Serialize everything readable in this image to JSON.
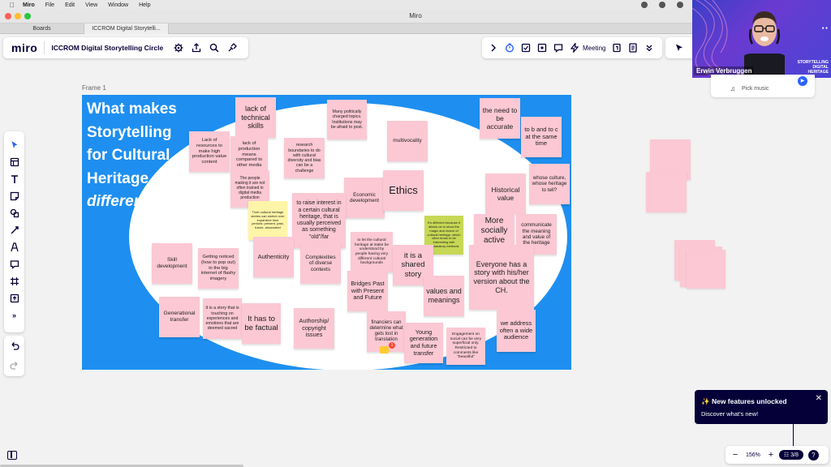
{
  "menubar": {
    "items": [
      "Miro",
      "File",
      "Edit",
      "View",
      "Window",
      "Help"
    ]
  },
  "window": {
    "title": "Miro"
  },
  "tabs": [
    {
      "label": "Boards"
    },
    {
      "label": "ICCROM Digital Storytelli..."
    }
  ],
  "toolbar": {
    "logo": "miro",
    "board_name": "ICCROM Digital Storytelling Circle",
    "meeting_label": "Meeting"
  },
  "video": {
    "name": "Erwin Verbruggen",
    "logo_line1": "STORYTELLING",
    "logo_line2": "DIGITAL",
    "logo_line3": "HERITAGE"
  },
  "music": {
    "label": "Pick music"
  },
  "frame": {
    "label": "Frame 1",
    "heading_lines": [
      "What makes",
      "Storytelling",
      "for Cultural",
      "Heritage"
    ],
    "heading_italic": "differen"
  },
  "stickies": [
    {
      "text": "lack of technical skills"
    },
    {
      "text": "Lack of resources to make high production value content"
    },
    {
      "text": "lack of production means compared to other media"
    },
    {
      "text": "The people making it are not often trained in digital media production"
    },
    {
      "text": "research boundaries to do with cultural diversity and bias can be a challenge"
    },
    {
      "text": "Many politically charged topics. Institutions may be afraid to post."
    },
    {
      "text": "multivocality"
    },
    {
      "text": "the need to be accurate"
    },
    {
      "text": "to b and to c at the same time"
    },
    {
      "text": "whose culture, whose heritage to tell?"
    },
    {
      "text": "Economic development"
    },
    {
      "text": "Ethics"
    },
    {
      "text": "Historical value"
    },
    {
      "text": "Their cultural heritage stories can stretch over expansive time periods: present, past, future, associated"
    },
    {
      "text": "to raise interest in a certain cultural heritage, that is usually perceived as something \"old\"/far"
    },
    {
      "text": "It's different because it allows us to show the magic and charm of cultural heritage, which often tends to be interesting with explanatory methods"
    },
    {
      "text": "More socially active"
    },
    {
      "text": "communicate the meaning and value of the heritage"
    },
    {
      "text": "Skill development"
    },
    {
      "text": "Getting noticed (how to pop out) in the big internet of flashy imagery"
    },
    {
      "text": "Authenticity"
    },
    {
      "text": "Complexities of diverse contexts"
    },
    {
      "text": "to let the cultural heritage at stake be understood by people having very different cultural backgrounds"
    },
    {
      "text": "it is a shared story"
    },
    {
      "text": "Everyone has a story with his/her version about the CH."
    },
    {
      "text": "Bridges Past with Present and Future"
    },
    {
      "text": "values and meanings"
    },
    {
      "text": "Generational transfer"
    },
    {
      "text": "It is a story that is touching on experiences and emotions that are deemed sacred"
    },
    {
      "text": "It has to be factual"
    },
    {
      "text": "Authorship/ copyright issues"
    },
    {
      "text": "financiers can determine what gets lost in translation"
    },
    {
      "text": "Young generation and future transfer"
    },
    {
      "text": "Engagement on social can be very superficial only. Restricted to comments like \"beautiful\""
    },
    {
      "text": "we address often a wide audience"
    }
  ],
  "comment_badge": "1",
  "notification": {
    "title": "New features unlocked",
    "subtitle": "Discover what's new!"
  },
  "zoom": {
    "minus": "−",
    "percent": "156%",
    "plus": "+",
    "pages": "3/8",
    "help": "?"
  },
  "colors": {
    "frame_blue": "#1e8ff0",
    "sticky_pink": "#fbc8d4",
    "sticky_yellow": "#fff5a8",
    "sticky_green": "#c6d855",
    "navy": "#050038"
  }
}
